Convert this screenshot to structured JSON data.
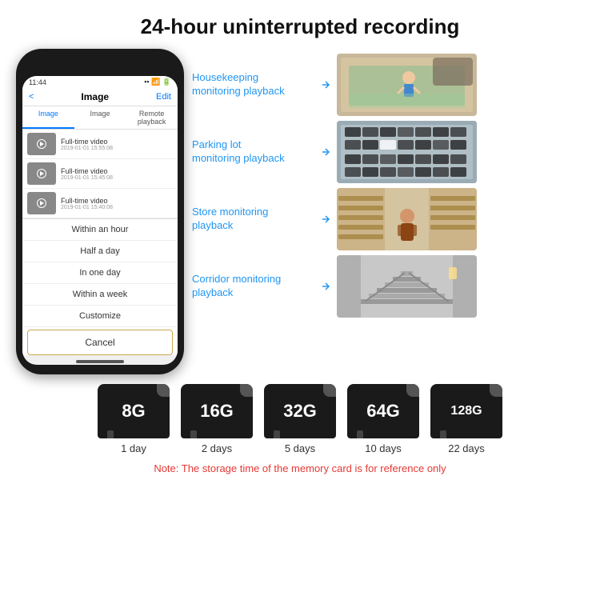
{
  "title": "24-hour uninterrupted recording",
  "phone": {
    "time": "11:44",
    "nav_back": "<",
    "nav_title": "Image",
    "nav_edit": "Edit",
    "tabs": [
      "Image",
      "Image",
      "Remote playback"
    ],
    "list_items": [
      {
        "label": "Full-time video",
        "sub": "2019-01-01 15:55:08"
      },
      {
        "label": "Full-time video",
        "sub": "2019-01-01 15:45:08"
      },
      {
        "label": "Full-time video",
        "sub": "2019-01-01 15:40:08"
      }
    ],
    "dropdown_items": [
      "Within an hour",
      "Half a day",
      "In one day",
      "Within a week",
      "Customize"
    ],
    "cancel_label": "Cancel"
  },
  "monitoring": [
    {
      "label": "Housekeeping\nmonitoring playback",
      "photo_bg": "#8B7355",
      "photo_desc": "child playing on mat"
    },
    {
      "label": "Parking lot\nmonitoring playback",
      "photo_bg": "#6B7C8B",
      "photo_desc": "parking lot aerial view"
    },
    {
      "label": "Store monitoring\nplayback",
      "photo_bg": "#7B6B5B",
      "photo_desc": "store interior"
    },
    {
      "label": "Corridor monitoring\nplayback",
      "photo_bg": "#888888",
      "photo_desc": "corridor stairs"
    }
  ],
  "storage_cards": [
    {
      "size": "8G",
      "days": "1 day"
    },
    {
      "size": "16G",
      "days": "2 days"
    },
    {
      "size": "32G",
      "days": "5 days"
    },
    {
      "size": "64G",
      "days": "10 days"
    },
    {
      "size": "128G",
      "days": "22 days"
    }
  ],
  "storage_note": "Note: The storage time of the memory card is for reference only"
}
